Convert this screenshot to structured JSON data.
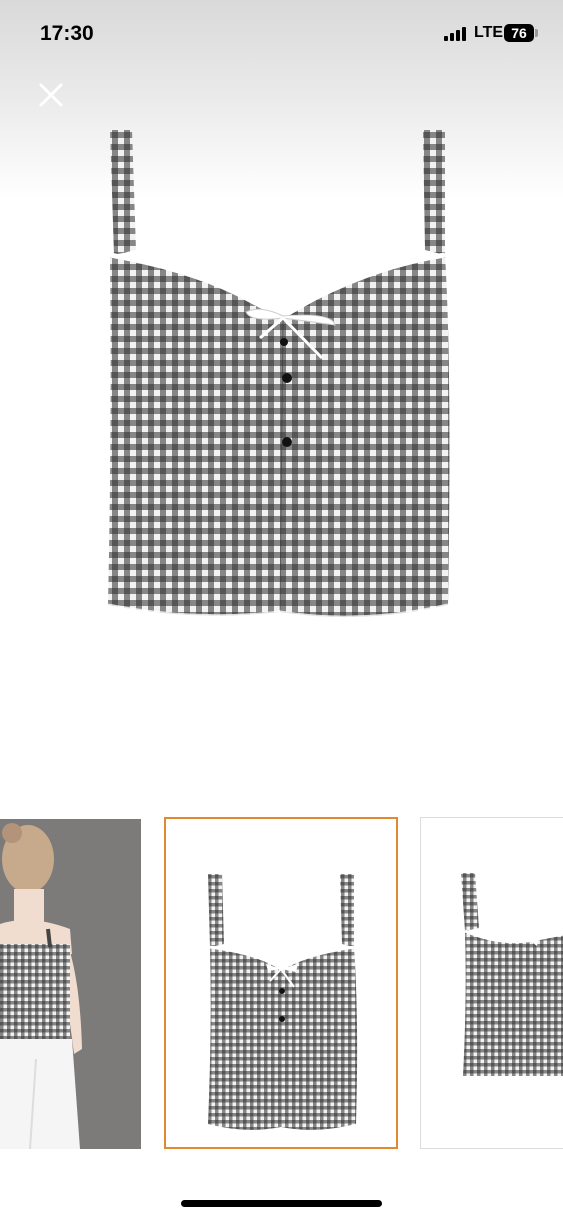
{
  "status_bar": {
    "time": "17:30",
    "network": "LTE",
    "battery": "76"
  },
  "icons": {
    "close": "close-icon",
    "signal": "cellular-signal-icon",
    "battery": "battery-icon"
  },
  "gallery": {
    "selected_index": 1,
    "thumbnails": [
      "model-back-view",
      "product-front-view",
      "product-back-view"
    ]
  },
  "colors": {
    "selected_border": "#e0892e",
    "gingham_dark": "#2e2e2e",
    "gingham_light": "#f2f2f2"
  }
}
